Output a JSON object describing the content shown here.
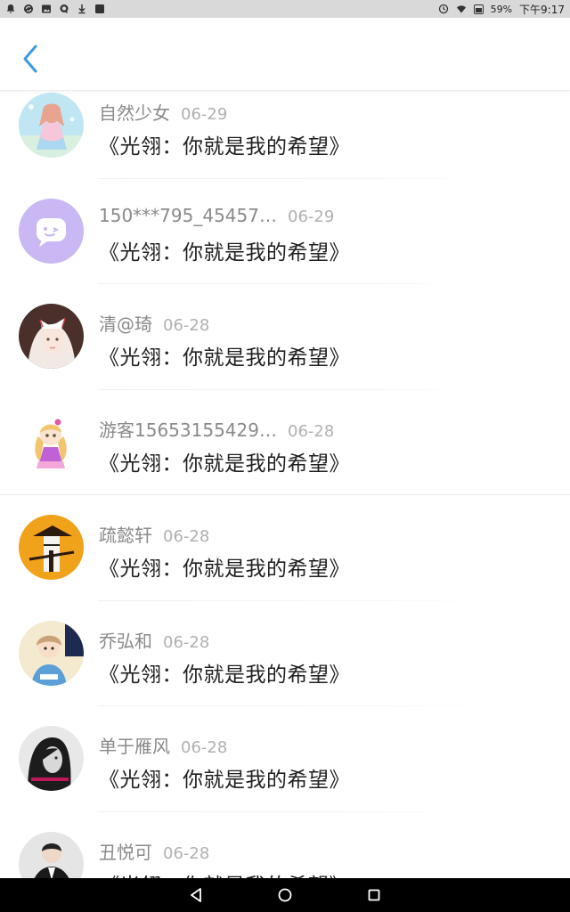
{
  "status_bar": {
    "left_icons": [
      "notification-bell-icon",
      "sync-icon",
      "image-icon",
      "qq-icon",
      "download-icon",
      "app-icon"
    ],
    "battery": "59%",
    "time": "下午9:17"
  },
  "header": {
    "back_icon": "chevron-left-icon",
    "accent_color": "#3a9be0"
  },
  "comments": [
    {
      "username": "自然少女",
      "date": "06-29",
      "message": "《光翎：你就是我的希望》",
      "avatar": "anime-girl-avatar"
    },
    {
      "username": "150***795_454578...",
      "date": "06-29",
      "message": "《光翎：你就是我的希望》",
      "avatar": "purple-chat-avatar"
    },
    {
      "username": "清@琦",
      "date": "06-28",
      "message": "《光翎：你就是我的希望》",
      "avatar": "fox-mask-girl-avatar"
    },
    {
      "username": "游客156531554291..",
      "date": "06-28",
      "message": "《光翎：你就是我的希望》",
      "avatar": "cartoon-doll-avatar"
    },
    {
      "username": "疏懿轩",
      "date": "06-28",
      "message": "《光翎：你就是我的希望》",
      "avatar": "swordsman-avatar"
    },
    {
      "username": "乔弘和",
      "date": "06-28",
      "message": "《光翎：你就是我的希望》",
      "avatar": "boy-avatar"
    },
    {
      "username": "单于雁风",
      "date": "06-28",
      "message": "《光翎：你就是我的希望》",
      "avatar": "monochrome-girl-avatar"
    },
    {
      "username": "丑悦可",
      "date": "06-28",
      "message": "《光翎：你就是我的希望》",
      "avatar": "man-suit-avatar"
    }
  ],
  "nav_bar": {
    "buttons": [
      "back-triangle-icon",
      "home-circle-icon",
      "recents-square-icon"
    ]
  }
}
